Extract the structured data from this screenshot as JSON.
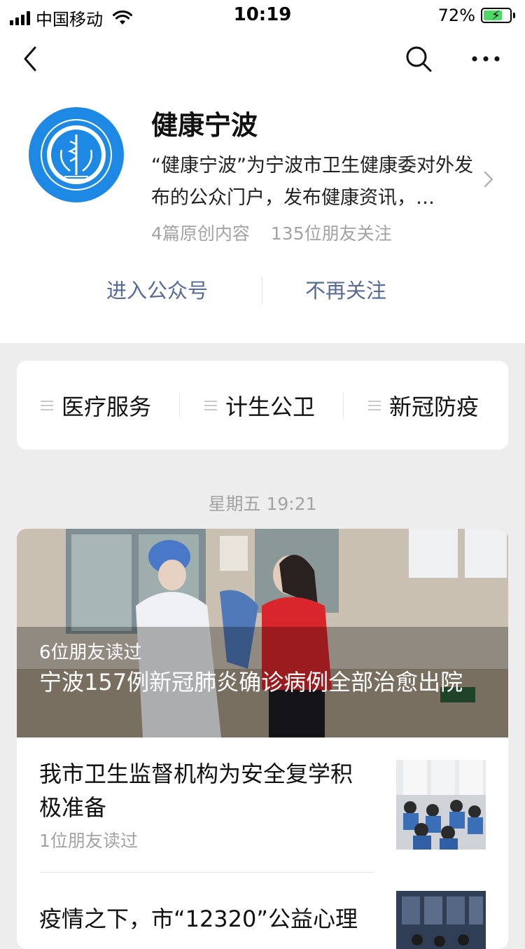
{
  "status_bar": {
    "carrier": "中国移动",
    "time": "10:19",
    "battery": "72%",
    "battery_level": 0.72
  },
  "account": {
    "name": "健康宁波",
    "description": "“健康宁波”为宁波市卫生健康委对外发布的公众门户，发布健康资讯，…",
    "original_count": "4篇原创内容",
    "followers": "135位朋友关注"
  },
  "actions": {
    "enter": "进入公众号",
    "unfollow": "不再关注"
  },
  "menu": [
    {
      "label": "医疗服务"
    },
    {
      "label": "计生公卫"
    },
    {
      "label": "新冠防疫"
    }
  ],
  "message_time": "星期五 19:21",
  "articles": {
    "cover": {
      "read_by": "6位朋友读过",
      "title": "宁波157例新冠肺炎确诊病例全部治愈出院"
    },
    "items": [
      {
        "title": "我市卫生监督机构为安全复学积极准备",
        "read_by": "1位朋友读过"
      },
      {
        "title": "疫情之下，市“12320”公益心理"
      }
    ]
  },
  "colors": {
    "link": "#576b95",
    "muted": "#a3a3a3",
    "background": "#ededed",
    "logo_blue": "#1e88e5",
    "battery_green": "#4cd964"
  },
  "icons": [
    "back-icon",
    "search-icon",
    "more-icon",
    "chevron-right-icon",
    "menu-list-icon",
    "wifi-icon",
    "battery-icon",
    "signal-icon"
  ]
}
